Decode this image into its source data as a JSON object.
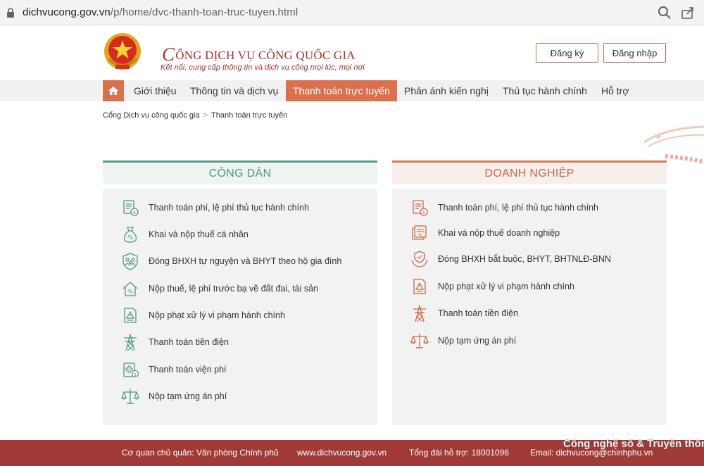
{
  "browser": {
    "url_host": "dichvucong.gov.vn",
    "url_path": "/p/home/dvc-thanh-toan-truc-tuyen.html"
  },
  "header": {
    "title_initial": "C",
    "title_rest": "ỔNG DỊCH VỤ CÔNG QUỐC GIA",
    "tagline": "Kết nối, cung cấp thông tin và dịch vụ công mọi lúc, mọi nơi",
    "register_label": "Đăng ký",
    "login_label": "Đăng nhập"
  },
  "nav": {
    "items": [
      {
        "label": "Giới thiệu"
      },
      {
        "label": "Thông tin và dịch vụ"
      },
      {
        "label": "Thanh toán trực tuyến"
      },
      {
        "label": "Phản ánh kiến nghị"
      },
      {
        "label": "Thủ tục hành chính"
      },
      {
        "label": "Hỗ trợ"
      }
    ],
    "active_index": 2
  },
  "breadcrumb": {
    "home": "Cổng Dịch vụ công quốc gia",
    "separator": ">",
    "current": "Thanh toán trực tuyến"
  },
  "cong_dan": {
    "title": "CÔNG DÂN",
    "accent": "#4d9686",
    "items": [
      {
        "label": "Thanh toán phí, lệ phí thủ tục hành chính",
        "icon": "document-fee-icon"
      },
      {
        "label": "Khai và nộp thuế cá nhân",
        "icon": "money-bag-icon"
      },
      {
        "label": "Đóng BHXH tự nguyện và BHYT theo hộ gia đình",
        "icon": "family-shield-icon"
      },
      {
        "label": "Nộp thuế, lệ phí trước bạ về đất đai, tài sản",
        "icon": "house-percent-icon"
      },
      {
        "label": "Nộp phạt xử lý vi phạm hành chính",
        "icon": "warning-document-icon"
      },
      {
        "label": "Thanh toán tiền điện",
        "icon": "power-tower-icon"
      },
      {
        "label": "Thanh toán viện phí",
        "icon": "hospital-bill-icon"
      },
      {
        "label": "Nộp tạm ứng án phí",
        "icon": "scales-icon"
      }
    ]
  },
  "doanh_nghiep": {
    "title": "DOANH NGHIỆP",
    "accent": "#c8674a",
    "items": [
      {
        "label": "Thanh toán phí, lệ phí thủ tục hành chính",
        "icon": "document-fee-icon"
      },
      {
        "label": "Khai và nộp thuế doanh nghiệp",
        "icon": "business-tax-icon"
      },
      {
        "label": "Đóng BHXH bắt buộc, BHYT, BHTNLĐ-BNN",
        "icon": "hands-shield-icon"
      },
      {
        "label": "Nộp phạt xử lý vi phạm hành chính",
        "icon": "warning-document-icon"
      },
      {
        "label": "Thanh toán tiền điện",
        "icon": "power-tower-icon"
      },
      {
        "label": "Nộp tạm ứng án phí",
        "icon": "scales-icon"
      }
    ]
  },
  "footer": {
    "agency": "Cơ quan chủ quản: Văn phòng Chính phủ",
    "website": "www.dichvucong.gov.vn",
    "hotline": "Tổng đài hỗ trợ: 18001096",
    "email": "Email: dichvucong@chinhphu.vn",
    "watermark": "Công nghệ số & Truyền thông"
  }
}
